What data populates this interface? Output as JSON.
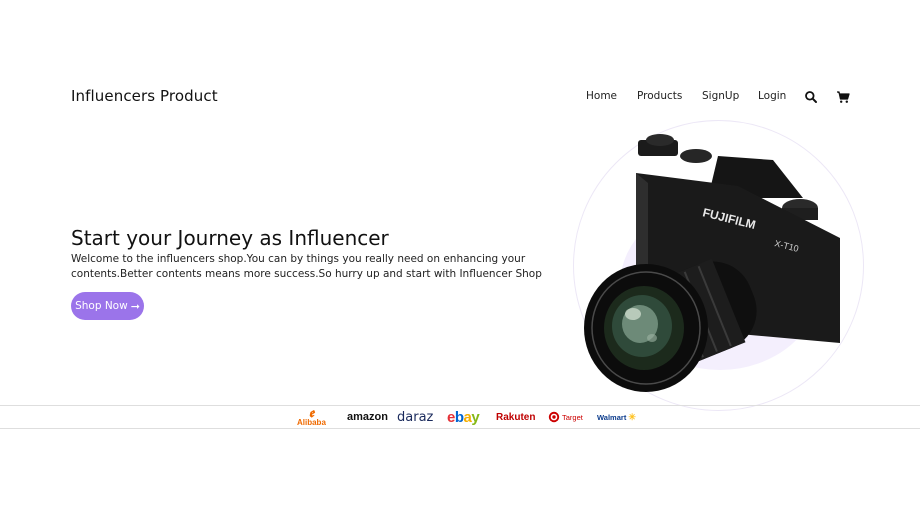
{
  "header": {
    "brand": "Influencers Product",
    "menu": [
      "Home",
      "Products",
      "SignUp",
      "Login"
    ],
    "icons": [
      "search-icon",
      "cart-icon"
    ]
  },
  "hero": {
    "title": "Start your Journey as Influencer",
    "description": "Welcome to the influencers shop.You can by things you really need on enhancing your contents.Better contents means more success.So hurry up and start with Influencer Shop",
    "button_label": "Shop Now",
    "button_icon": "arrow-right-icon",
    "image_text": [
      "FUJIFILM",
      "X-T10"
    ]
  },
  "brands": {
    "alibaba": "Alibaba",
    "amazon": "amazon",
    "daraz": "daraz",
    "ebay_parts": [
      "e",
      "b",
      "a",
      "y"
    ],
    "rakuten": "Rakuten",
    "target": "Target",
    "walmart": "Walmart"
  },
  "colors": {
    "accent": "#9b74ea",
    "ring": "#ece7f6",
    "blob": "#f4effd",
    "ebay": [
      "#e53238",
      "#0064d2",
      "#f5af02",
      "#86b817"
    ]
  }
}
